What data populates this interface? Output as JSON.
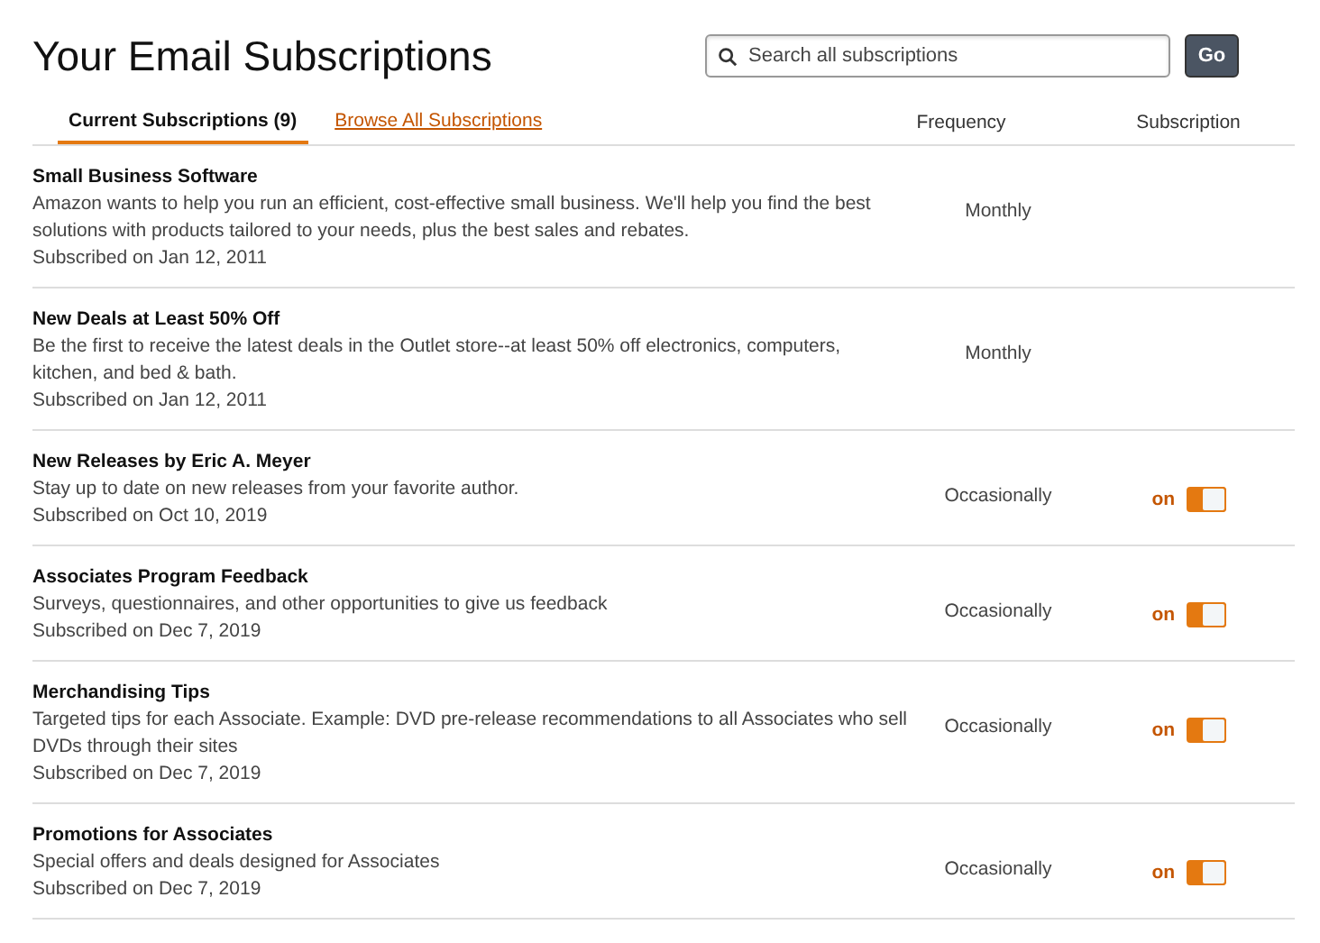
{
  "title": "Your Email Subscriptions",
  "search": {
    "placeholder": "Search all subscriptions",
    "button": "Go"
  },
  "tabs": [
    {
      "label": "Current Subscriptions (9)",
      "selected": true
    },
    {
      "label": "Browse All Subscriptions",
      "selected": false
    }
  ],
  "columns": [
    "Frequency",
    "Subscription"
  ],
  "rows": [
    {
      "name": "Small Business Software",
      "description": "Amazon wants to help you run an efficient, cost-effective small business. We'll help you find the best solutions with products tailored to your needs, plus the best sales and rebates.",
      "subscribed": "Subscribed on Jan 12, 2011",
      "frequency": "Monthly"
    },
    {
      "name": "New Deals at Least 50% Off",
      "description": "Be the first to receive the latest deals in the Outlet store--at least 50% off electronics, computers, kitchen, and bed & bath.",
      "subscribed": "Subscribed on Jan 12, 2011",
      "frequency": "Monthly"
    },
    {
      "name": "New Releases by Eric A. Meyer",
      "description": "Stay up to date on new releases from your favorite author.",
      "subscribed": "Subscribed on Oct 10, 2019",
      "frequency": "Occasionally",
      "toggle": {
        "label": "on",
        "on": true
      }
    },
    {
      "name": "Associates Program Feedback",
      "description": "Surveys, questionnaires, and other opportunities to give us feedback",
      "subscribed": "Subscribed on Dec 7, 2019",
      "frequency": "Occasionally",
      "toggle": {
        "label": "on",
        "on": true
      }
    },
    {
      "name": "Merchandising Tips",
      "description": "Targeted tips for each Associate. Example: DVD pre-release recommendations to all Associates who sell DVDs through their sites",
      "subscribed": "Subscribed on Dec 7, 2019",
      "frequency": "Occasionally",
      "toggle": {
        "label": "on",
        "on": true
      }
    },
    {
      "name": "Promotions for Associates",
      "description": "Special offers and deals designed for Associates",
      "subscribed": "Subscribed on Dec 7, 2019",
      "frequency": "Occasionally",
      "toggle": {
        "label": "on",
        "on": true
      }
    }
  ]
}
